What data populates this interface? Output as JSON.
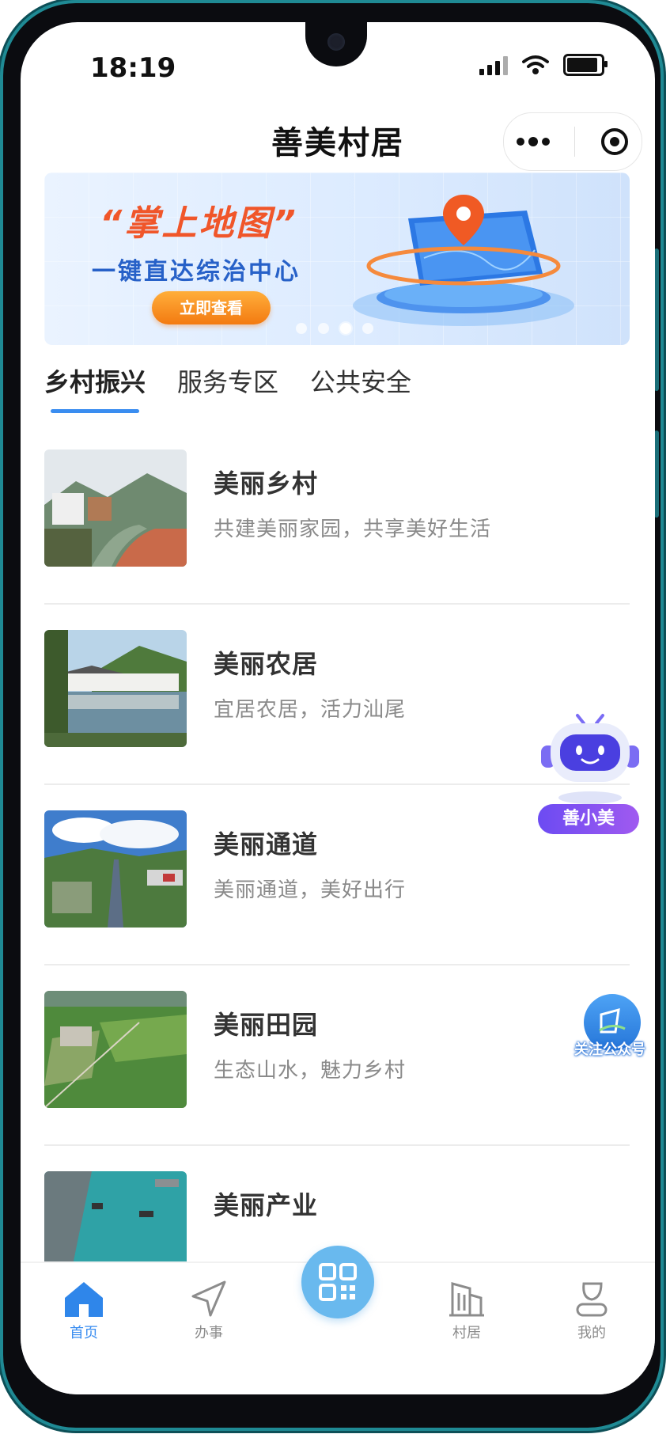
{
  "status_bar": {
    "time": "18:19"
  },
  "nav": {
    "title": "善美村居"
  },
  "banner": {
    "title": "“掌上地图”",
    "subtitle": "一键直达综治中心",
    "button_label": "立即查看"
  },
  "tabs": [
    {
      "label": "乡村振兴",
      "active": true
    },
    {
      "label": "服务专区",
      "active": false
    },
    {
      "label": "公共安全",
      "active": false
    }
  ],
  "list": [
    {
      "title": "美丽乡村",
      "desc": "共建美丽家园，共享美好生活"
    },
    {
      "title": "美丽农居",
      "desc": "宜居农居，活力汕尾"
    },
    {
      "title": "美丽通道",
      "desc": "美丽通道，美好出行"
    },
    {
      "title": "美丽田园",
      "desc": "生态山水，魅力乡村"
    },
    {
      "title": "美丽产业",
      "desc": ""
    }
  ],
  "float": {
    "robot_label": "善小美",
    "follow_label": "关注公众号"
  },
  "tabbar": [
    {
      "label": "首页",
      "icon": "home-icon",
      "active": true
    },
    {
      "label": "办事",
      "icon": "send-icon",
      "active": false
    },
    {
      "label": "",
      "icon": "qr-scan-icon",
      "active": false
    },
    {
      "label": "村居",
      "icon": "building-icon",
      "active": false
    },
    {
      "label": "我的",
      "icon": "user-icon",
      "active": false
    }
  ],
  "colors": {
    "accent": "#3a8df0",
    "banner_orange": "#f0562a",
    "banner_blue": "#2761c8",
    "robot_purple": "#6c4bf2"
  }
}
